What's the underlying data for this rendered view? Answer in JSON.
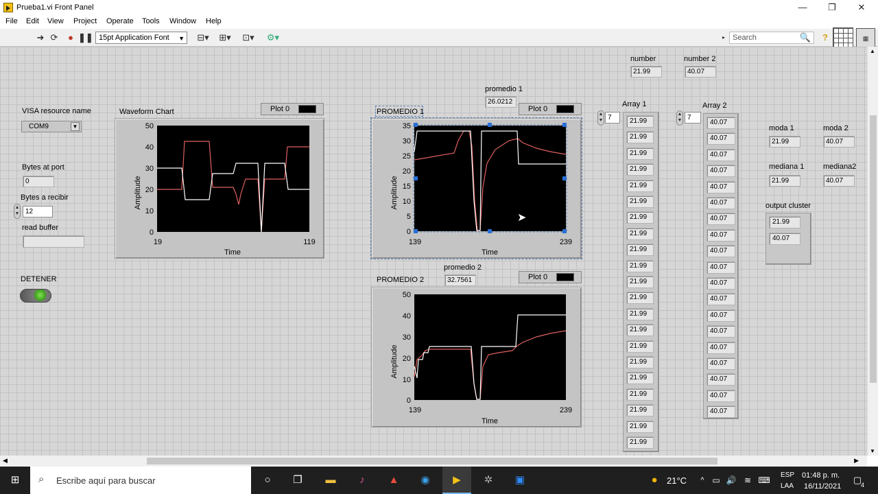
{
  "window": {
    "title": "Prueba1.vi Front Panel",
    "minimize": "—",
    "maximize": "❐",
    "close": "✕"
  },
  "menu": [
    "File",
    "Edit",
    "View",
    "Project",
    "Operate",
    "Tools",
    "Window",
    "Help"
  ],
  "toolbar": {
    "font": "15pt Application Font",
    "search_placeholder": "Search"
  },
  "controls": {
    "visa_label": "VISA resource name",
    "visa_value": "COM9",
    "bytes_at_port_label": "Bytes at port",
    "bytes_at_port_value": "0",
    "bytes_a_recibir_label": "Bytes a recibir",
    "bytes_a_recibir_value": "12",
    "read_buffer_label": "read buffer",
    "read_buffer_value": "",
    "detener_label": "DETENER"
  },
  "waveform": {
    "label": "Waveform Chart",
    "legend": "Plot 0",
    "xlabel": "Time",
    "ylabel": "Amplitude",
    "xmin": "19",
    "xmax": "119"
  },
  "promedio1_chart": {
    "label": "PROMEDIO 1",
    "legend": "Plot 0",
    "xlabel": "Time",
    "ylabel": "Amplitude",
    "xmin": "139",
    "xmax": "239"
  },
  "promedio2_chart": {
    "label": "PROMEDIO 2",
    "legend": "Plot 0",
    "xlabel": "Time",
    "ylabel": "Amplitude",
    "xmin": "139",
    "xmax": "239"
  },
  "promedio1": {
    "label": "promedio 1",
    "value": "26.0212"
  },
  "promedio2": {
    "label": "promedio 2",
    "value": "32.7561"
  },
  "number": {
    "label": "number",
    "value": "21.99"
  },
  "number2": {
    "label": "number 2",
    "value": "40.07"
  },
  "array1": {
    "label": "Array 1",
    "index": "7",
    "values": [
      "21.99",
      "21.99",
      "21.99",
      "21.99",
      "21.99",
      "21.99",
      "21.99",
      "21.99",
      "21.99",
      "21.99",
      "21.99",
      "21.99",
      "21.99",
      "21.99",
      "21.99",
      "21.99",
      "21.99",
      "21.99",
      "21.99",
      "21.99",
      "21.99"
    ]
  },
  "array2": {
    "label": "Array 2",
    "index": "7",
    "values": [
      "40.07",
      "40.07",
      "40.07",
      "40.07",
      "40.07",
      "40.07",
      "40.07",
      "40.07",
      "40.07",
      "40.07",
      "40.07",
      "40.07",
      "40.07",
      "40.07",
      "40.07",
      "40.07",
      "40.07",
      "40.07",
      "40.07"
    ]
  },
  "moda1": {
    "label": "moda 1",
    "value": "21.99"
  },
  "moda2": {
    "label": "moda 2",
    "value": "40.07"
  },
  "mediana1": {
    "label": "mediana 1",
    "value": "21.99"
  },
  "mediana2": {
    "label": "mediana2",
    "value": "40.07"
  },
  "output_cluster": {
    "label": "output cluster",
    "v1": "21.99",
    "v2": "40.07"
  },
  "taskbar": {
    "search": "Escribe aquí para buscar",
    "temp": "21°C",
    "lang1": "ESP",
    "lang2": "LAA",
    "time": "01:48 p. m.",
    "date": "16/11/2021",
    "notif": "4"
  },
  "colors": {
    "panel": "#d6d6d6",
    "plot_bg": "#000000",
    "trace_white": "#ffffff",
    "trace_red": "#e07a7a",
    "accent": "#2a6fd6"
  }
}
